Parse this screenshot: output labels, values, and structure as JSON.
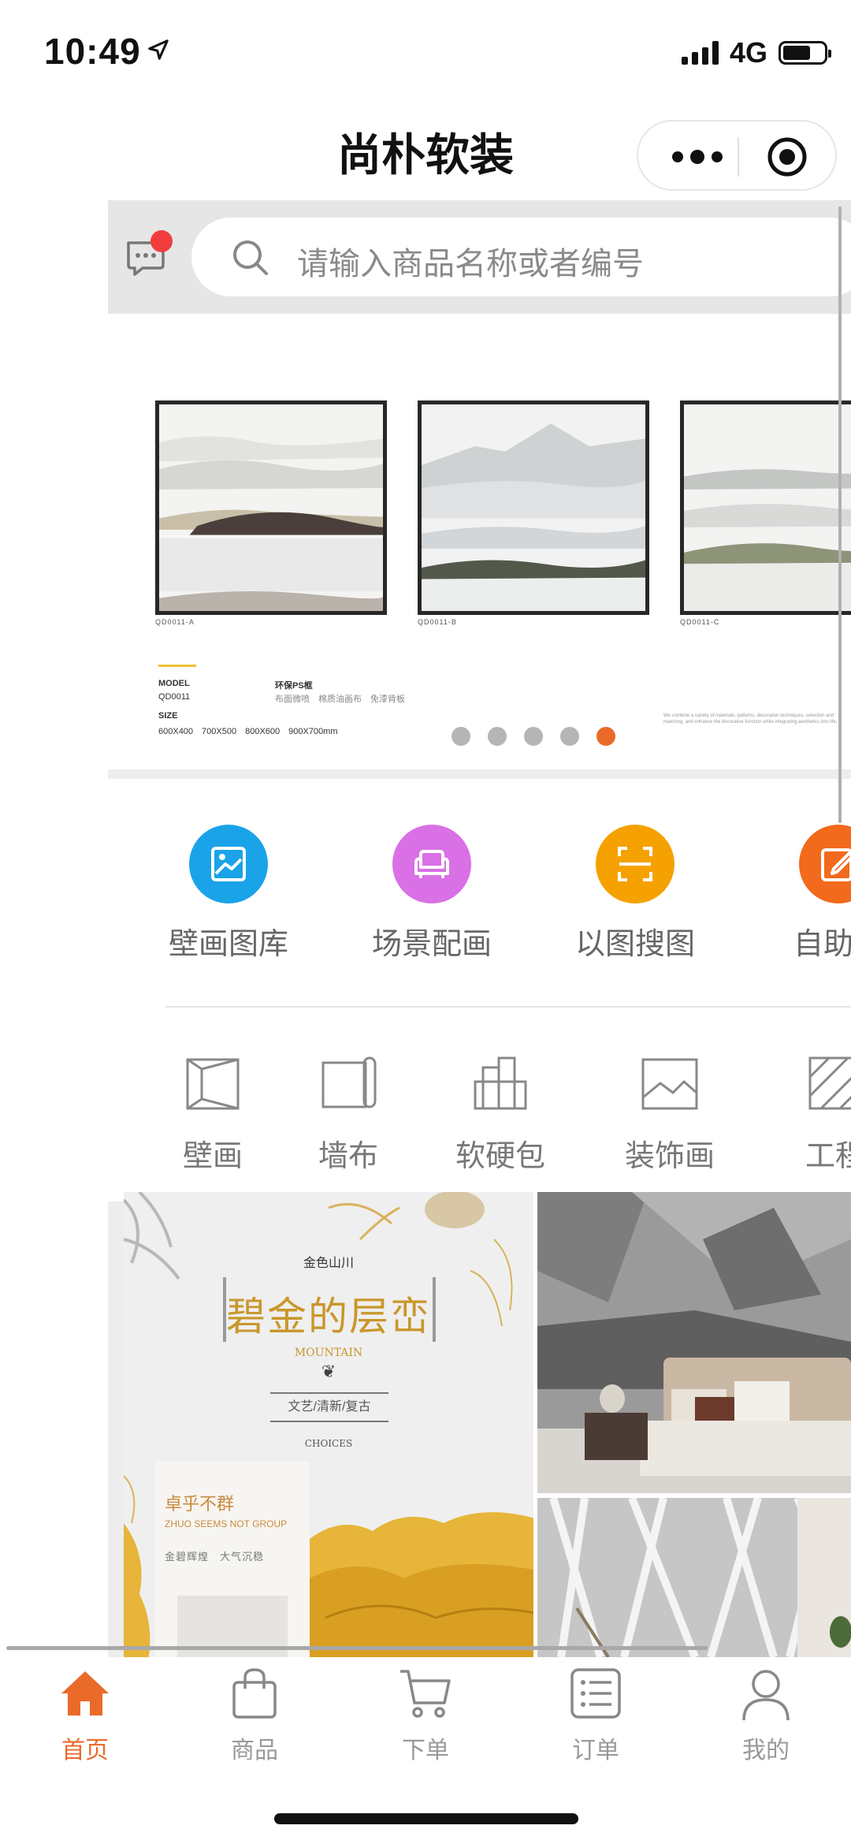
{
  "status_bar": {
    "time": "10:49",
    "network": "4G",
    "battery_level": 0.68
  },
  "header": {
    "title": "尚朴软装"
  },
  "search": {
    "placeholder": "请输入商品名称或者编号"
  },
  "banner": {
    "codes": [
      "QD0011-A",
      "QD0011-B",
      "QD0011-C"
    ],
    "model_label": "MODEL",
    "model_value": "QD0011",
    "frame_label": "环保PS框",
    "materials": "布面微喷　棉质油画布　免漆背板",
    "size_label": "SIZE",
    "size_value": "600X400　700X500　800X600　900X700mm",
    "fine_print": "We combine a variety of materials, patterns, decoration techniques, selection and matching, and enhance the decorative function while integrating aesthetics into life.",
    "dots_total": 5,
    "active_dot": 5
  },
  "quick_menu": [
    {
      "label": "壁画图库",
      "icon": "gallery-icon",
      "color": "#1aa3e8"
    },
    {
      "label": "场景配画",
      "icon": "sofa-icon",
      "color": "#d970e6"
    },
    {
      "label": "以图搜图",
      "icon": "scan-icon",
      "color": "#f5a100"
    },
    {
      "label": "自助设",
      "icon": "edit-icon",
      "color": "#f26a1b"
    }
  ],
  "categories": [
    {
      "label": "壁画",
      "icon": "mural-icon"
    },
    {
      "label": "墙布",
      "icon": "wallcloth-icon"
    },
    {
      "label": "软硬包",
      "icon": "panel-icon"
    },
    {
      "label": "装饰画",
      "icon": "painting-icon"
    },
    {
      "label": "工程",
      "icon": "project-icon"
    }
  ],
  "promo": {
    "top_text": "金色山川",
    "title": "碧金的层峦",
    "subtitle": "MOUNTAIN",
    "styles": "文艺/清新/复古",
    "choices": "CHOICES",
    "card_title": "卓乎不群",
    "card_subtitle": "ZHUO SEEMS NOT GROUP",
    "card_desc": "金碧辉煌　大气沉稳"
  },
  "tab_bar": [
    {
      "label": "首页",
      "icon": "home-icon",
      "active": true
    },
    {
      "label": "商品",
      "icon": "bag-icon",
      "active": false
    },
    {
      "label": "下单",
      "icon": "cart-icon",
      "active": false
    },
    {
      "label": "订单",
      "icon": "list-icon",
      "active": false
    },
    {
      "label": "我的",
      "icon": "user-icon",
      "active": false
    }
  ],
  "colors": {
    "accent": "#ea6a2a",
    "badge": "#f23d3d"
  }
}
